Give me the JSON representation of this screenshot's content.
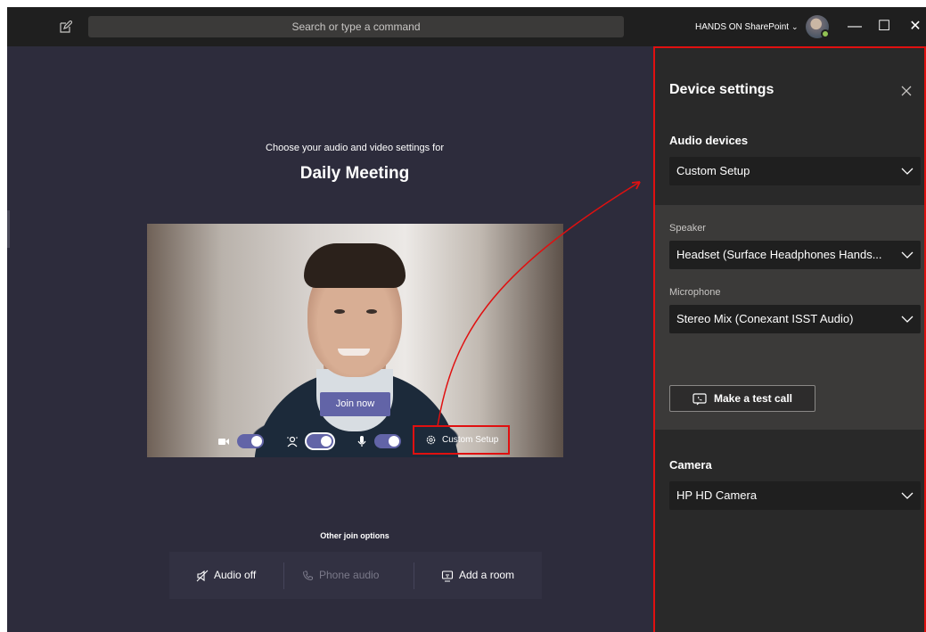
{
  "titlebar": {
    "search_placeholder": "Search or type a command",
    "org_name": "HANDS ON SharePoint",
    "org_chevron": "⌄",
    "minimize": "—",
    "maximize": "☐",
    "close": "✕"
  },
  "prejoin": {
    "subtitle": "Choose your audio and video settings for",
    "meeting_title": "Daily Meeting",
    "join_label": "Join now",
    "controls": {
      "camera_on": true,
      "blur_on": true,
      "mic_on": true,
      "custom_setup_label": "Custom Setup"
    },
    "other_options_title": "Other join options",
    "other_options": {
      "audio_off": "Audio off",
      "phone_audio": "Phone audio",
      "add_room": "Add a room"
    }
  },
  "device_settings": {
    "title": "Device settings",
    "audio_devices_label": "Audio devices",
    "audio_devices_value": "Custom Setup",
    "speaker_label": "Speaker",
    "speaker_value": "Headset (Surface Headphones Hands...",
    "microphone_label": "Microphone",
    "microphone_value": "Stereo Mix (Conexant ISST Audio)",
    "test_call_label": "Make a test call",
    "camera_label": "Camera",
    "camera_value": "HP HD Camera"
  },
  "colors": {
    "accent": "#6264a7",
    "annotation": "#e01010",
    "presence": "#92c353"
  },
  "icons": [
    "compose-icon",
    "camera-icon",
    "blur-icon",
    "mic-icon",
    "gear-icon",
    "speaker-off-icon",
    "phone-icon",
    "room-icon",
    "close-icon",
    "chevron-down-icon",
    "test-call-icon"
  ]
}
